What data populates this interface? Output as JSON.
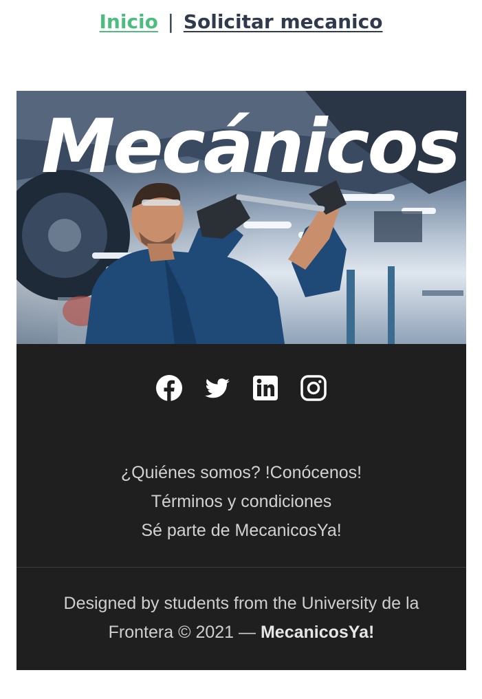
{
  "nav": {
    "home_label": "Inicio",
    "separator": "|",
    "request_label": "Solicitar mecanico",
    "home_color": "#4cbd7f",
    "request_color": "#2f3a4c"
  },
  "hero": {
    "title": "Mecánicos",
    "image_description_icon": "mechanic-photo"
  },
  "social": [
    {
      "icon": "facebook-icon"
    },
    {
      "icon": "twitter-icon"
    },
    {
      "icon": "linkedin-icon"
    },
    {
      "icon": "instagram-icon"
    }
  ],
  "footer": {
    "links": [
      "¿Quiénes somos? !Conócenos!",
      "Términos y condiciones",
      "Sé parte de MecanicosYa!"
    ],
    "credits_line1": "Designed by students from the University de la",
    "credits_line2": "Frontera © 2021 —",
    "brand": "MecanicosYa!",
    "background": "#1f1f1f"
  }
}
